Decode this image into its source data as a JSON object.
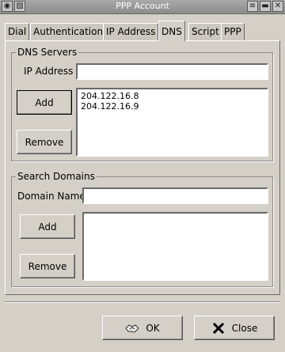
{
  "window": {
    "title": "PPP Account",
    "controls": [
      "menu-icon",
      "minimize-icon",
      "close-icon"
    ]
  },
  "tabs": [
    {
      "label": "Dial",
      "active": false
    },
    {
      "label": "Authentication",
      "active": false
    },
    {
      "label": "IP Address",
      "active": false
    },
    {
      "label": "DNS",
      "active": true
    },
    {
      "label": "Script",
      "active": false
    },
    {
      "label": "PPP",
      "active": false
    }
  ],
  "dns_servers": {
    "group_label": "DNS Servers",
    "ip_label": "IP Address",
    "ip_value": "",
    "add_label": "Add",
    "remove_label": "Remove",
    "servers": [
      "204.122.16.8",
      "204.122.16.9"
    ]
  },
  "search_domains": {
    "group_label": "Search Domains",
    "domain_label": "Domain Name",
    "domain_value": "",
    "add_label": "Add",
    "remove_label": "Remove",
    "domains": []
  },
  "footer": {
    "ok_label": "OK",
    "close_label": "Close"
  }
}
